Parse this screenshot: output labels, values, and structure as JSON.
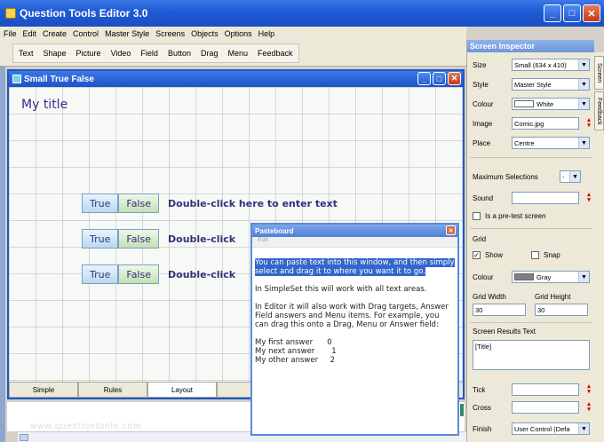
{
  "app": {
    "title": "Question Tools Editor 3.0"
  },
  "menu": [
    "File",
    "Edit",
    "Create",
    "Control",
    "Master Style",
    "Screens",
    "Objects",
    "Options",
    "Help"
  ],
  "toolbar": [
    "Text",
    "Shape",
    "Picture",
    "Video",
    "Field",
    "Button",
    "Drag",
    "Menu",
    "Feedback"
  ],
  "doc": {
    "title": "Small True False",
    "heading": "My title",
    "rows": [
      {
        "true_label": "True",
        "false_label": "False",
        "text": "Double-click here to enter text"
      },
      {
        "true_label": "True",
        "false_label": "False",
        "text": "Double-click"
      },
      {
        "true_label": "True",
        "false_label": "False",
        "text": "Double-click"
      }
    ],
    "tabs": [
      "Simple",
      "Rules",
      "Layout",
      ""
    ],
    "watermark": "www.questiontools.com"
  },
  "pasteboard": {
    "title": "Pasteboard",
    "menu": "Edit",
    "highlight": "You can paste text into this window, and then simply select and drag it to where you want it to go.",
    "para2": "In SimpleSet this will work with all text areas.",
    "para3": "In Editor it will also work with Drag targets, Answer Field answers and Menu items. For example, you can drag this onto a Drag, Menu or Answer field:",
    "answers": [
      "My first answer      0",
      "My next answer       1",
      "My other answer     2"
    ]
  },
  "inspector": {
    "title": "Screen Inspector",
    "size_label": "Size",
    "size_value": "Small (634 x 410)",
    "style_label": "Style",
    "style_value": "Master Style",
    "colour_label": "Colour",
    "colour_value": "White",
    "image_label": "Image",
    "image_value": "Comic.jpg",
    "place_label": "Place",
    "place_value": "Centre",
    "maxsel_label": "Maximum Selections",
    "maxsel_value": "-",
    "sound_label": "Sound",
    "sound_value": "",
    "pretest_label": "Is a pre-test screen",
    "grid_label": "Grid",
    "show_label": "Show",
    "snap_label": "Snap",
    "grid_colour_label": "Colour",
    "grid_colour_value": "Gray",
    "gw_label": "Grid Width",
    "gh_label": "Grid Height",
    "gw_value": "30",
    "gh_value": "30",
    "results_label": "Screen Results Text",
    "results_value": "[Title]",
    "tick_label": "Tick",
    "cross_label": "Cross",
    "finish_label": "Finish",
    "finish_value": "User Control (Defa",
    "side_tabs": [
      "Screen",
      "Feedback"
    ]
  },
  "colors": {
    "titlebar": "#1f5bd6",
    "highlight": "#3366cc",
    "heading": "#3b2a8a"
  }
}
